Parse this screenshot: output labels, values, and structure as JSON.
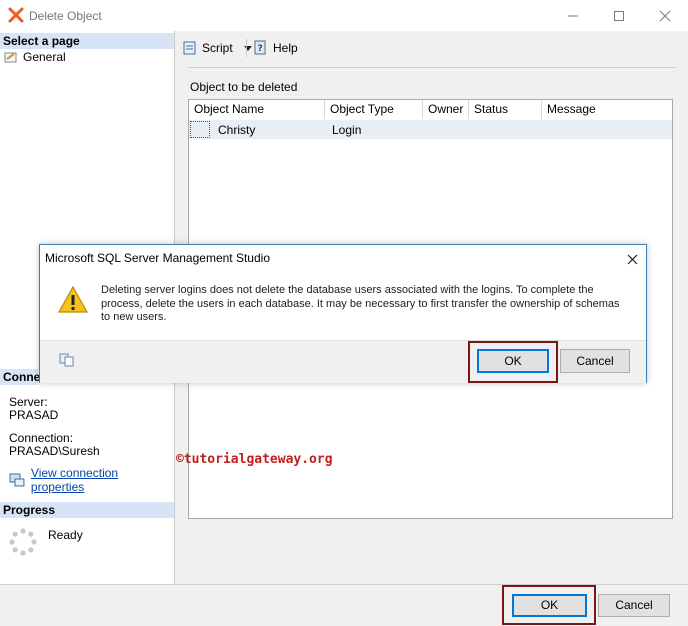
{
  "window": {
    "title": "Delete Object"
  },
  "left_panel": {
    "select_page_header": "Select a page",
    "pages": [
      {
        "label": "General",
        "icon": "wrench-page-icon"
      }
    ],
    "connection_header": "Conne",
    "server_label": "Server:",
    "server_value": "PRASAD",
    "connection_label": "Connection:",
    "connection_value": "PRASAD\\Suresh",
    "view_connection_link": "View connection properties",
    "progress_header": "Progress",
    "progress_status": "Ready"
  },
  "toolbar": {
    "script_label": "Script",
    "help_label": "Help"
  },
  "main": {
    "section_label": "Object to be deleted",
    "columns": [
      "Object Name",
      "Object Type",
      "Owner",
      "Status",
      "Message"
    ],
    "rows": [
      {
        "name": "Christy",
        "type": "Login",
        "owner": "",
        "status": "",
        "message": ""
      }
    ]
  },
  "dialog": {
    "title": "Microsoft SQL Server Management Studio",
    "message": "Deleting server logins does not delete the database users associated with the logins. To complete the process, delete the users in each database. It may be necessary to first transfer the ownership of schemas to new users.",
    "ok_label": "OK",
    "cancel_label": "Cancel"
  },
  "footer": {
    "ok_label": "OK",
    "cancel_label": "Cancel"
  },
  "watermark": "©tutorialgateway.org",
  "colors": {
    "accent": "#0078d7",
    "highlight_box": "#7b1616",
    "section_header": "#d6e4f5",
    "watermark": "#c02020"
  }
}
